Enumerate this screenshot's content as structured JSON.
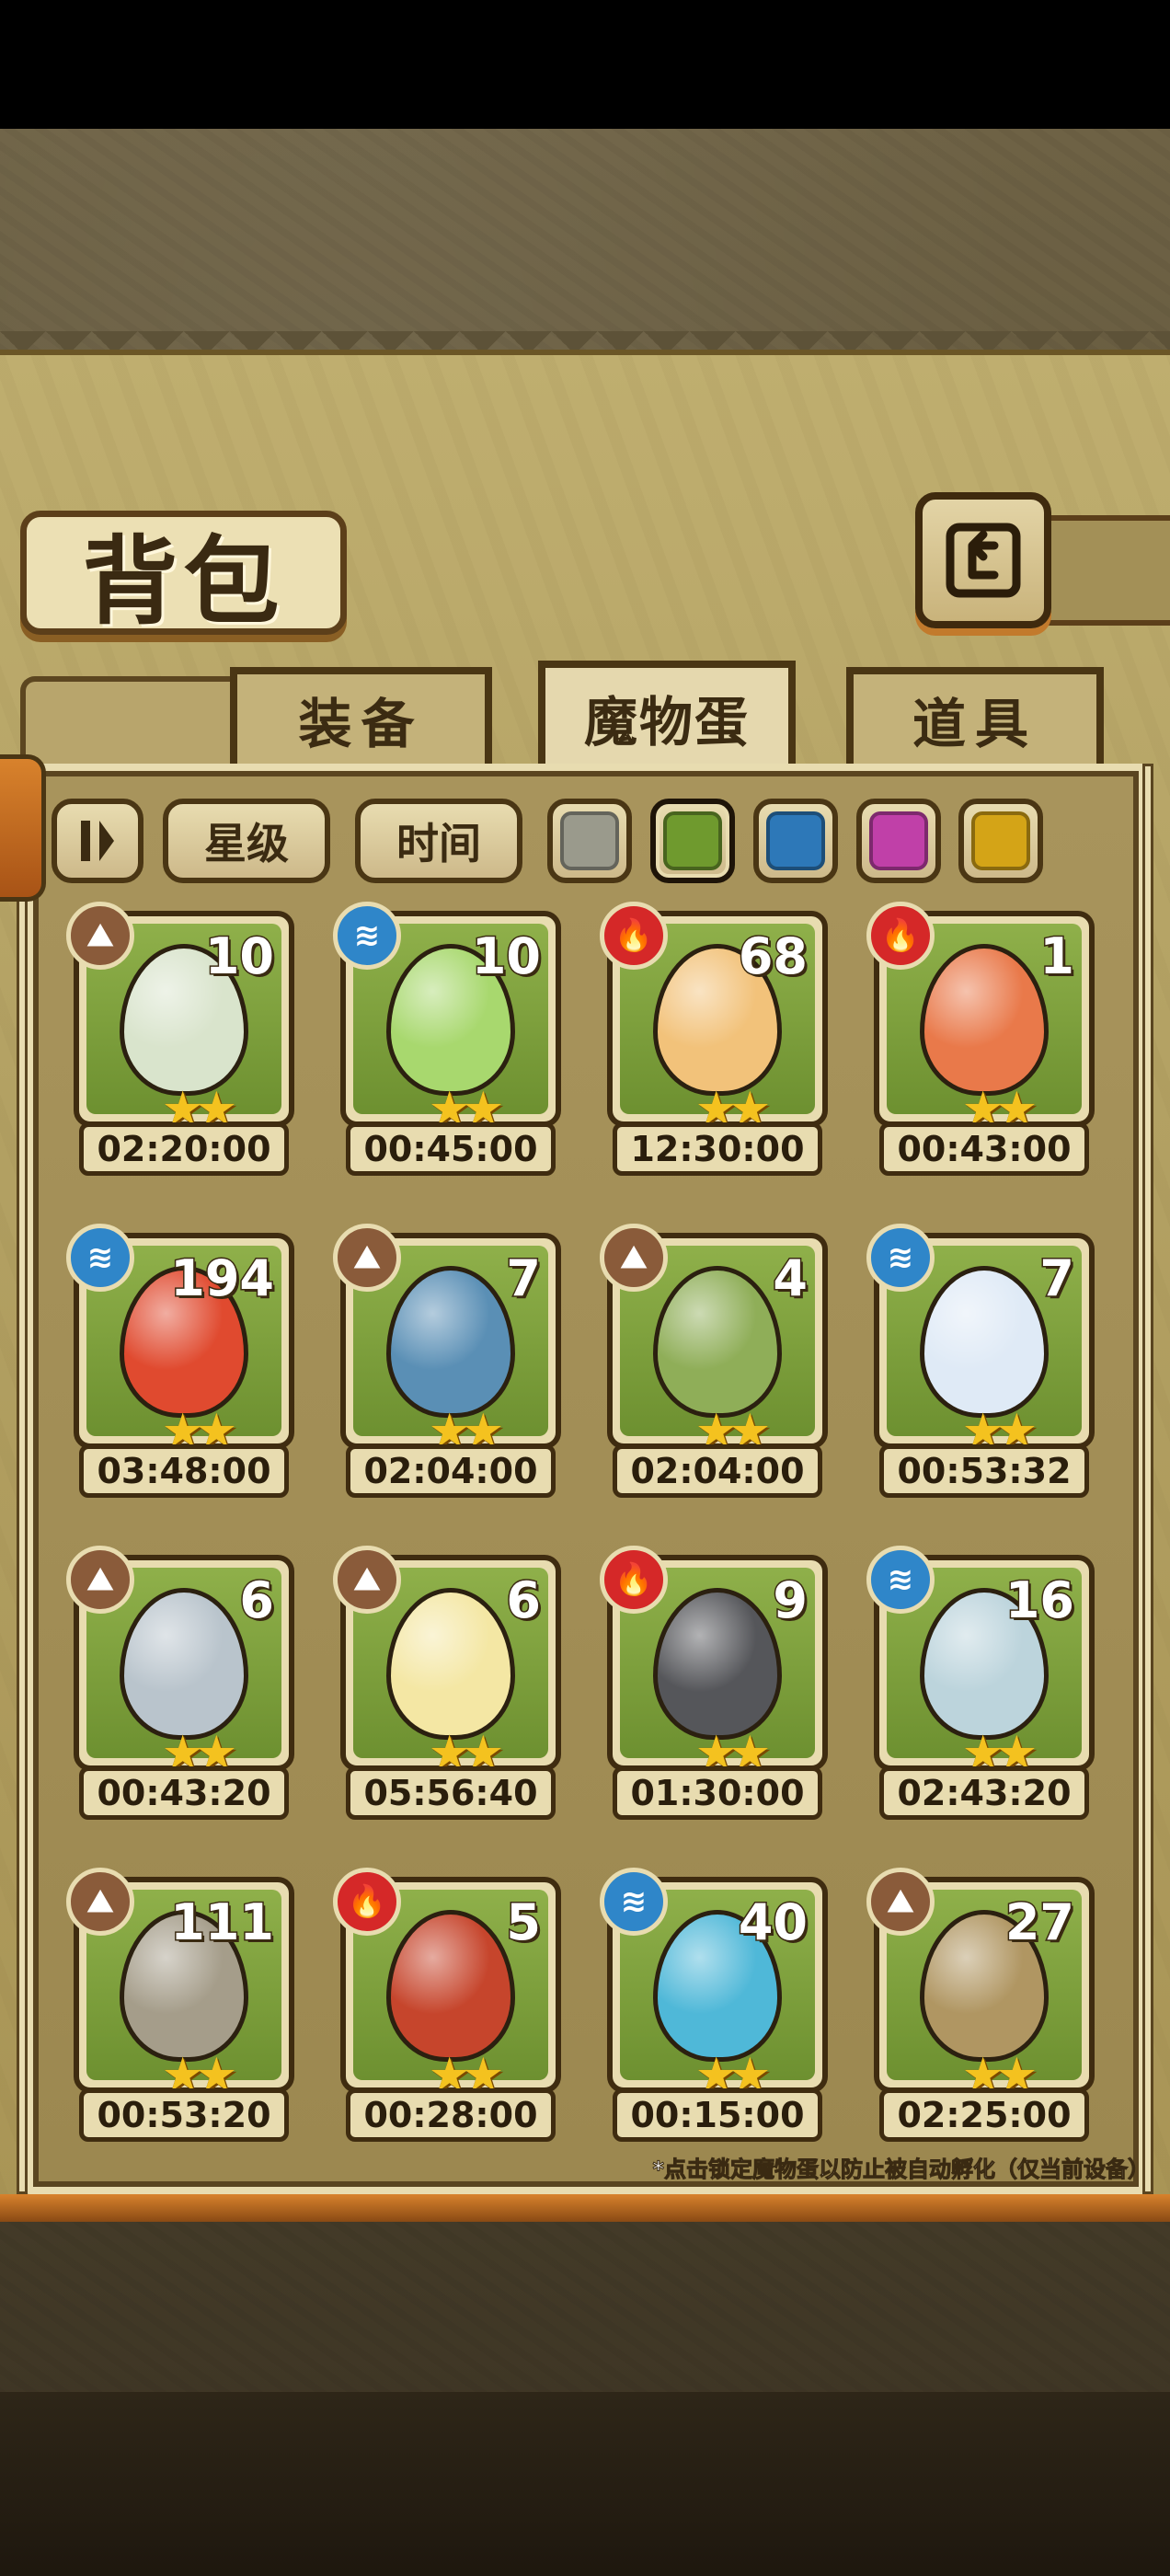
{
  "header": {
    "title": "背包"
  },
  "tabs": [
    {
      "label": "装备",
      "active": false
    },
    {
      "label": "魔物蛋",
      "active": true
    },
    {
      "label": "道具",
      "active": false
    }
  ],
  "filters": {
    "sort_icon": "sort-toggle-icon",
    "star_label": "星级",
    "time_label": "时间",
    "colors": [
      "#9a9a8c",
      "#6f9a2e",
      "#2d78b8",
      "#c040a8",
      "#d4a417"
    ],
    "selected_color_index": 1
  },
  "eggs": [
    {
      "count": "10",
      "element": "earth",
      "timer": "02:20:00",
      "color": "#d9e4cc"
    },
    {
      "count": "10",
      "element": "water",
      "timer": "00:45:00",
      "color": "#a8d86e"
    },
    {
      "count": "68",
      "element": "fire",
      "timer": "12:30:00",
      "color": "#f2c27a"
    },
    {
      "count": "1",
      "element": "fire",
      "timer": "00:43:00",
      "color": "#e9794a"
    },
    {
      "count": "194",
      "element": "water",
      "timer": "03:48:00",
      "color": "#e04a2f"
    },
    {
      "count": "7",
      "element": "earth",
      "timer": "02:04:00",
      "color": "#5a8fb5"
    },
    {
      "count": "4",
      "element": "earth",
      "timer": "02:04:00",
      "color": "#8fae58"
    },
    {
      "count": "7",
      "element": "water",
      "timer": "00:53:32",
      "color": "#dfeaf6"
    },
    {
      "count": "6",
      "element": "earth",
      "timer": "00:43:20",
      "color": "#b9c4cc"
    },
    {
      "count": "6",
      "element": "earth",
      "timer": "05:56:40",
      "color": "#f4e7a4"
    },
    {
      "count": "9",
      "element": "fire",
      "timer": "01:30:00",
      "color": "#55565a"
    },
    {
      "count": "16",
      "element": "water",
      "timer": "02:43:20",
      "color": "#bcd4dc"
    },
    {
      "count": "111",
      "element": "earth",
      "timer": "00:53:20",
      "color": "#a59d8a"
    },
    {
      "count": "5",
      "element": "fire",
      "timer": "00:28:00",
      "color": "#c6452c"
    },
    {
      "count": "40",
      "element": "water",
      "timer": "00:15:00",
      "color": "#4fb8d8"
    },
    {
      "count": "27",
      "element": "earth",
      "timer": "02:25:00",
      "color": "#b09662"
    }
  ],
  "element_icons": {
    "earth": "mountain-icon",
    "water": "wave-icon",
    "fire": "flame-icon"
  },
  "footnote": "*点击锁定魔物蛋以防止被自动孵化（仅当前设备）"
}
